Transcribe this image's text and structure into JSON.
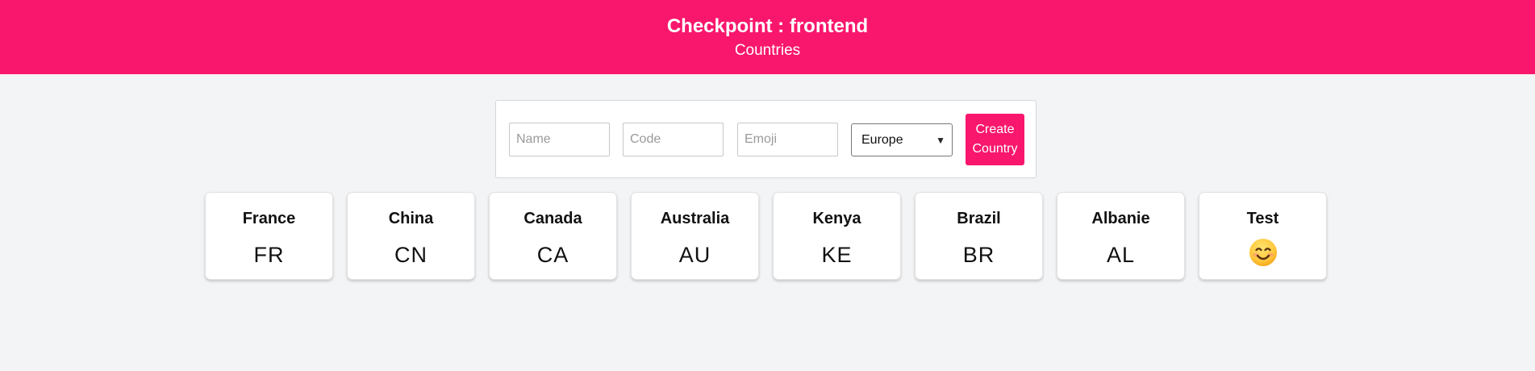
{
  "header": {
    "title": "Checkpoint : frontend",
    "subtitle": "Countries"
  },
  "form": {
    "name_placeholder": "Name",
    "code_placeholder": "Code",
    "emoji_placeholder": "Emoji",
    "continent_selected": "Europe",
    "create_label": "Create\nCountry"
  },
  "countries": [
    {
      "name": "France",
      "code": "FR"
    },
    {
      "name": "China",
      "code": "CN"
    },
    {
      "name": "Canada",
      "code": "CA"
    },
    {
      "name": "Australia",
      "code": "AU"
    },
    {
      "name": "Kenya",
      "code": "KE"
    },
    {
      "name": "Brazil",
      "code": "BR"
    },
    {
      "name": "Albanie",
      "code": "AL"
    },
    {
      "name": "Test",
      "icon": "smiling-face-icon"
    }
  ],
  "colors": {
    "accent": "#f9176d",
    "background": "#f3f4f6",
    "card": "#ffffff"
  }
}
